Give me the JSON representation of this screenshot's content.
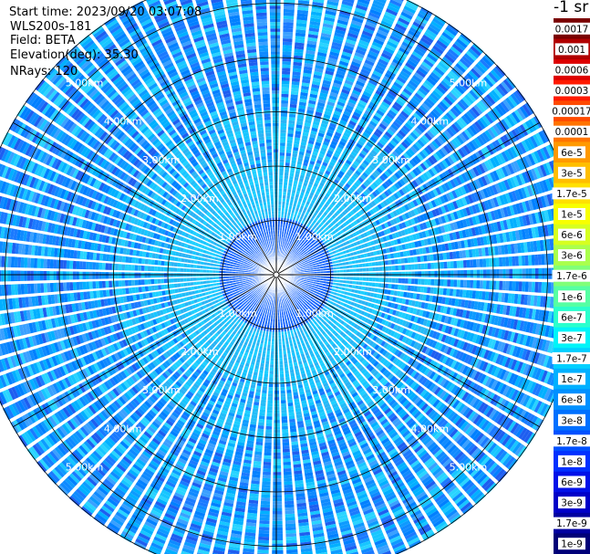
{
  "info": {
    "start_time": "Start time: 2023/09/20 03:07:08",
    "device": "WLS200s-181",
    "field": "Field: BETA",
    "elevation": "Elevation(deg): 35.30",
    "nrays": "NRays: 120"
  },
  "colorbar": {
    "unit": "-1 sr",
    "entries": [
      {
        "label": "0.0017",
        "color": "#7a0000",
        "text_color": "#ffffff"
      },
      {
        "label": "0.001",
        "color": "#b00000",
        "text_color": "#ffffff"
      },
      {
        "label": "0.0006",
        "color": "#dd0000",
        "text_color": "#ffffff"
      },
      {
        "label": "0.0003",
        "color": "#ff1a00",
        "text_color": "#ffffff"
      },
      {
        "label": "0.00017",
        "color": "#ff4a00",
        "text_color": "#000000"
      },
      {
        "label": "0.0001",
        "color": "#ff7300",
        "text_color": "#000000"
      },
      {
        "label": "6e-5",
        "color": "#ff9900",
        "text_color": "#000000"
      },
      {
        "label": "3e-5",
        "color": "#ffbe00",
        "text_color": "#000000"
      },
      {
        "label": "1.7e-5",
        "color": "#ffe000",
        "text_color": "#000000"
      },
      {
        "label": "1e-5",
        "color": "#f8ff00",
        "text_color": "#000000"
      },
      {
        "label": "6e-6",
        "color": "#d6ff20",
        "text_color": "#000000"
      },
      {
        "label": "3e-6",
        "color": "#aaff4c",
        "text_color": "#000000"
      },
      {
        "label": "1.7e-6",
        "color": "#80ff78",
        "text_color": "#000000"
      },
      {
        "label": "1e-6",
        "color": "#55ffa3",
        "text_color": "#000000"
      },
      {
        "label": "6e-7",
        "color": "#2affcd",
        "text_color": "#000000"
      },
      {
        "label": "3e-7",
        "color": "#00f4f8",
        "text_color": "#000000"
      },
      {
        "label": "1.7e-7",
        "color": "#00d0ff",
        "text_color": "#000000"
      },
      {
        "label": "1e-7",
        "color": "#00b0ff",
        "text_color": "#000000"
      },
      {
        "label": "6e-8",
        "color": "#0090ff",
        "text_color": "#000000"
      },
      {
        "label": "3e-8",
        "color": "#0070ff",
        "text_color": "#000000"
      },
      {
        "label": "1.7e-8",
        "color": "#0050ff",
        "text_color": "#000000"
      },
      {
        "label": "1e-8",
        "color": "#0030ff",
        "text_color": "#000000"
      },
      {
        "label": "6e-9",
        "color": "#0010e8",
        "text_color": "#000000"
      },
      {
        "label": "3e-9",
        "color": "#0000c8",
        "text_color": "#000000"
      },
      {
        "label": "1.7e-9",
        "color": "#0000a0",
        "text_color": "#000000"
      },
      {
        "label": "1e-9",
        "color": "#000078",
        "text_color": "#000000"
      }
    ]
  },
  "chart_data": {
    "type": "heatmap",
    "projection": "polar (PPI scan)",
    "field": "BETA",
    "elevation_deg": 35.3,
    "n_rays": 120,
    "range_rings_km": [
      1.0,
      2.0,
      3.0,
      4.0,
      5.0
    ],
    "ring_labels": [
      "1.00km",
      "2.00km",
      "3.00km",
      "4.00km",
      "5.00km"
    ],
    "max_range_km": 5.6,
    "spoke_angles_deg": [
      0,
      30,
      60,
      90,
      120,
      150,
      180,
      210,
      240,
      270,
      300,
      330
    ],
    "grid": true,
    "dominant_value_range": [
      "1e-8",
      "1.7e-7"
    ],
    "near_range_values": "about 3e-8 inside 1 km, about 1.7e-7 between 1 and 2 km, mixed 1e-8 to 1.7e-7 beyond 2 km",
    "colormap": "jet"
  }
}
